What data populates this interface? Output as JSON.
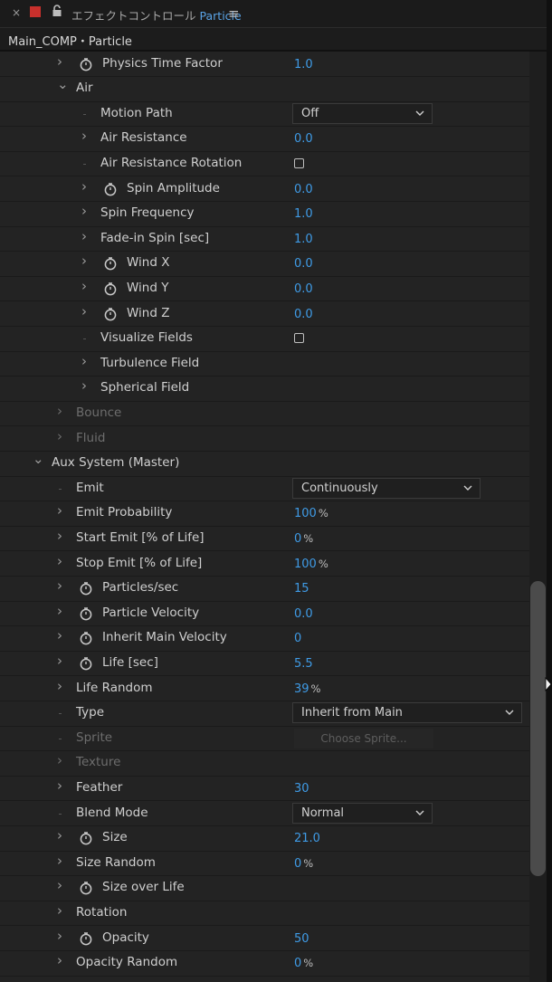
{
  "tab": {
    "close_glyph": "×",
    "title_prefix": "エフェクトコントロール",
    "title_layer": "Particle",
    "menu_glyph": "≡"
  },
  "breadcrumb": "Main_COMP・Particle",
  "colors": {
    "accent": "#3f9be6",
    "swatch": "#c8302c",
    "background": "#232323"
  },
  "rows": [
    {
      "indent": 2,
      "arrow": "right",
      "stopwatch": true,
      "label": "Physics Time Factor",
      "value": "1.0"
    },
    {
      "indent": 2,
      "arrow": "down",
      "label": "Air"
    },
    {
      "indent": 3,
      "arrow": "dot",
      "label": "Motion Path",
      "dropdown": "Off",
      "ddw": 155
    },
    {
      "indent": 3,
      "arrow": "right",
      "label": "Air Resistance",
      "value": "0.0"
    },
    {
      "indent": 3,
      "arrow": "dot",
      "label": "Air Resistance Rotation",
      "checkbox": false
    },
    {
      "indent": 3,
      "arrow": "right",
      "stopwatch": true,
      "label": "Spin Amplitude",
      "value": "0.0"
    },
    {
      "indent": 3,
      "arrow": "right",
      "label": "Spin Frequency",
      "value": "1.0"
    },
    {
      "indent": 3,
      "arrow": "right",
      "label": "Fade-in Spin [sec]",
      "value": "1.0"
    },
    {
      "indent": 3,
      "arrow": "right",
      "stopwatch": true,
      "label": "Wind X",
      "value": "0.0"
    },
    {
      "indent": 3,
      "arrow": "right",
      "stopwatch": true,
      "label": "Wind Y",
      "value": "0.0"
    },
    {
      "indent": 3,
      "arrow": "right",
      "stopwatch": true,
      "label": "Wind Z",
      "value": "0.0"
    },
    {
      "indent": 3,
      "arrow": "dot",
      "label": "Visualize Fields",
      "checkbox": false
    },
    {
      "indent": 3,
      "arrow": "right",
      "label": "Turbulence Field"
    },
    {
      "indent": 3,
      "arrow": "right",
      "label": "Spherical Field"
    },
    {
      "indent": 2,
      "arrow": "right",
      "label": "Bounce",
      "dim": true
    },
    {
      "indent": 2,
      "arrow": "right",
      "label": "Fluid",
      "dim": true
    },
    {
      "indent": 1,
      "arrow": "down",
      "label": "Aux System (Master)"
    },
    {
      "indent": 2,
      "arrow": "dot",
      "label": "Emit",
      "dropdown": "Continuously",
      "ddw": 208
    },
    {
      "indent": 2,
      "arrow": "right",
      "label": "Emit Probability",
      "value": "100",
      "unit": "%"
    },
    {
      "indent": 2,
      "arrow": "right",
      "label": "Start Emit [% of Life]",
      "value": "0",
      "unit": "%"
    },
    {
      "indent": 2,
      "arrow": "right",
      "label": "Stop Emit [% of Life]",
      "value": "100",
      "unit": "%"
    },
    {
      "indent": 2,
      "arrow": "right",
      "stopwatch": true,
      "label": "Particles/sec",
      "value": "15"
    },
    {
      "indent": 2,
      "arrow": "right",
      "stopwatch": true,
      "label": "Particle Velocity",
      "value": "0.0"
    },
    {
      "indent": 2,
      "arrow": "right",
      "stopwatch": true,
      "label": "Inherit Main Velocity",
      "value": "0"
    },
    {
      "indent": 2,
      "arrow": "right",
      "stopwatch": true,
      "label": "Life [sec]",
      "value": "5.5"
    },
    {
      "indent": 2,
      "arrow": "right",
      "label": "Life Random",
      "value": "39",
      "unit": "%"
    },
    {
      "indent": 2,
      "arrow": "dot",
      "label": "Type",
      "dropdown": "Inherit from Main",
      "ddw": 254
    },
    {
      "indent": 2,
      "arrow": "dot",
      "label": "Sprite",
      "dim": true,
      "button": "Choose Sprite..."
    },
    {
      "indent": 2,
      "arrow": "right",
      "label": "Texture",
      "dim": true
    },
    {
      "indent": 2,
      "arrow": "right",
      "label": "Feather",
      "value": "30"
    },
    {
      "indent": 2,
      "arrow": "dot",
      "label": "Blend Mode",
      "dropdown": "Normal",
      "ddw": 155
    },
    {
      "indent": 2,
      "arrow": "right",
      "stopwatch": true,
      "label": "Size",
      "value": "21.0"
    },
    {
      "indent": 2,
      "arrow": "right",
      "label": "Size Random",
      "value": "0",
      "unit": "%"
    },
    {
      "indent": 2,
      "arrow": "right",
      "stopwatch": true,
      "label": "Size over Life"
    },
    {
      "indent": 2,
      "arrow": "right",
      "label": "Rotation"
    },
    {
      "indent": 2,
      "arrow": "right",
      "stopwatch": true,
      "label": "Opacity",
      "value": "50"
    },
    {
      "indent": 2,
      "arrow": "right",
      "label": "Opacity Random",
      "value": "0",
      "unit": "%"
    }
  ]
}
